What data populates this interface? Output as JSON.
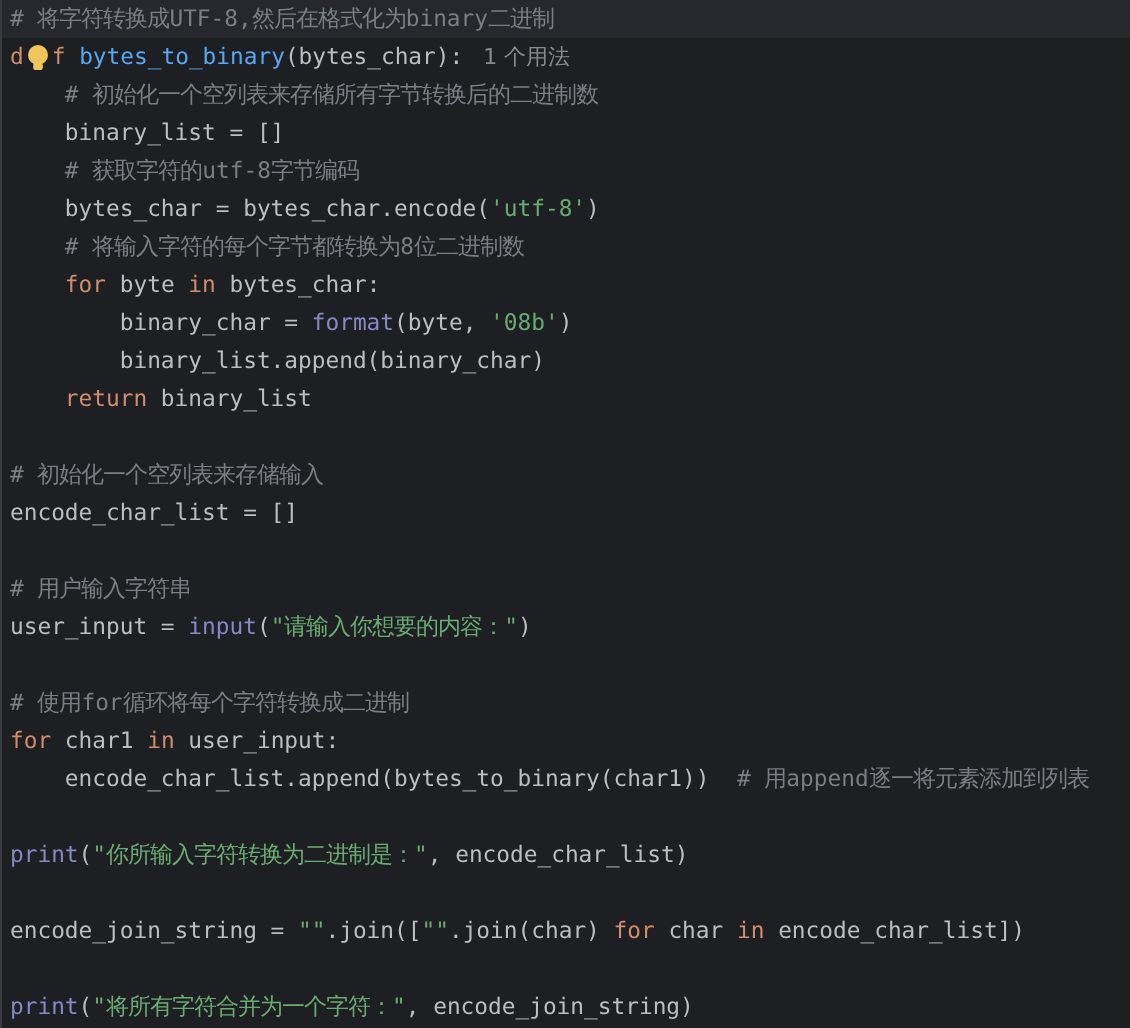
{
  "lines": [
    {
      "kind": "code",
      "current": true,
      "tokens": [
        {
          "kind": "comment",
          "text": "# 将字符转换成UTF-8,然后在格式化为binary二进制"
        }
      ]
    },
    {
      "kind": "code",
      "current": false,
      "tokens": [
        {
          "kind": "keyword",
          "text": "d"
        },
        {
          "kind": "bulb"
        },
        {
          "kind": "keyword",
          "text": "f"
        },
        {
          "kind": "function",
          "text": " bytes_to_binary"
        },
        {
          "kind": "plain",
          "text": "(bytes_char):"
        },
        {
          "kind": "hint",
          "text": "1 个用法"
        }
      ]
    },
    {
      "kind": "code",
      "current": false,
      "tokens": [
        {
          "kind": "comment",
          "text": "    # 初始化一个空列表来存储所有字节转换后的二进制数"
        }
      ]
    },
    {
      "kind": "code",
      "current": false,
      "tokens": [
        {
          "kind": "plain",
          "text": "    binary_list = []"
        }
      ]
    },
    {
      "kind": "code",
      "current": false,
      "tokens": [
        {
          "kind": "comment",
          "text": "    # 获取字符的utf-8字节编码"
        }
      ]
    },
    {
      "kind": "code",
      "current": false,
      "tokens": [
        {
          "kind": "plain",
          "text": "    bytes_char = bytes_char.encode("
        },
        {
          "kind": "string",
          "text": "'utf-8'"
        },
        {
          "kind": "plain",
          "text": ")"
        }
      ]
    },
    {
      "kind": "code",
      "current": false,
      "tokens": [
        {
          "kind": "comment",
          "text": "    # 将输入字符的每个字节都转换为8位二进制数"
        }
      ]
    },
    {
      "kind": "code",
      "current": false,
      "tokens": [
        {
          "kind": "keyword",
          "text": "    for"
        },
        {
          "kind": "plain",
          "text": " byte "
        },
        {
          "kind": "keyword",
          "text": "in"
        },
        {
          "kind": "plain",
          "text": " bytes_char:"
        }
      ]
    },
    {
      "kind": "code",
      "current": false,
      "tokens": [
        {
          "kind": "plain",
          "text": "        binary_char = "
        },
        {
          "kind": "builtin",
          "text": "format"
        },
        {
          "kind": "plain",
          "text": "(byte, "
        },
        {
          "kind": "string",
          "text": "'08b'"
        },
        {
          "kind": "plain",
          "text": ")"
        }
      ]
    },
    {
      "kind": "code",
      "current": false,
      "tokens": [
        {
          "kind": "plain",
          "text": "        binary_list.append(binary_char)"
        }
      ]
    },
    {
      "kind": "code",
      "current": false,
      "tokens": [
        {
          "kind": "keyword",
          "text": "    return"
        },
        {
          "kind": "plain",
          "text": " binary_list"
        }
      ]
    },
    {
      "kind": "blank",
      "current": false
    },
    {
      "kind": "code",
      "current": false,
      "tokens": [
        {
          "kind": "comment",
          "text": "# 初始化一个空列表来存储输入"
        }
      ]
    },
    {
      "kind": "code",
      "current": false,
      "tokens": [
        {
          "kind": "plain",
          "text": "encode_char_list = []"
        }
      ]
    },
    {
      "kind": "blank",
      "current": false
    },
    {
      "kind": "code",
      "current": false,
      "tokens": [
        {
          "kind": "comment",
          "text": "# 用户输入字符串"
        }
      ]
    },
    {
      "kind": "code",
      "current": false,
      "tokens": [
        {
          "kind": "plain",
          "text": "user_input = "
        },
        {
          "kind": "builtin",
          "text": "input"
        },
        {
          "kind": "plain",
          "text": "("
        },
        {
          "kind": "string",
          "text": "\"请输入你想要的内容：\""
        },
        {
          "kind": "plain",
          "text": ")"
        }
      ]
    },
    {
      "kind": "blank",
      "current": false
    },
    {
      "kind": "code",
      "current": false,
      "tokens": [
        {
          "kind": "comment",
          "text": "# 使用for循环将每个字符转换成二进制"
        }
      ]
    },
    {
      "kind": "code",
      "current": false,
      "tokens": [
        {
          "kind": "keyword",
          "text": "for"
        },
        {
          "kind": "plain",
          "text": " char1 "
        },
        {
          "kind": "keyword",
          "text": "in"
        },
        {
          "kind": "plain",
          "text": " user_input:"
        }
      ]
    },
    {
      "kind": "code",
      "current": false,
      "tokens": [
        {
          "kind": "plain",
          "text": "    encode_char_list.append(bytes_to_binary(char1))  "
        },
        {
          "kind": "comment",
          "text": "# 用append逐一将元素添加到列表"
        }
      ]
    },
    {
      "kind": "blank",
      "current": false
    },
    {
      "kind": "code",
      "current": false,
      "tokens": [
        {
          "kind": "builtin",
          "text": "print"
        },
        {
          "kind": "plain",
          "text": "("
        },
        {
          "kind": "string",
          "text": "\"你所输入字符转换为二进制是：\""
        },
        {
          "kind": "plain",
          "text": ", encode_char_list)"
        }
      ]
    },
    {
      "kind": "blank",
      "current": false
    },
    {
      "kind": "code",
      "current": false,
      "tokens": [
        {
          "kind": "plain",
          "text": "encode_join_string = "
        },
        {
          "kind": "string",
          "text": "\"\""
        },
        {
          "kind": "plain",
          "text": ".join(["
        },
        {
          "kind": "string",
          "text": "\"\""
        },
        {
          "kind": "plain",
          "text": ".join(char) "
        },
        {
          "kind": "keyword",
          "text": "for"
        },
        {
          "kind": "plain",
          "text": " char "
        },
        {
          "kind": "keyword",
          "text": "in"
        },
        {
          "kind": "plain",
          "text": " encode_char_list])"
        }
      ]
    },
    {
      "kind": "blank",
      "current": false
    },
    {
      "kind": "code",
      "current": false,
      "tokens": [
        {
          "kind": "builtin",
          "text": "print"
        },
        {
          "kind": "plain",
          "text": "("
        },
        {
          "kind": "string",
          "text": "\"将所有字符合并为一个字符：\""
        },
        {
          "kind": "plain",
          "text": ", encode_join_string)"
        }
      ]
    }
  ]
}
